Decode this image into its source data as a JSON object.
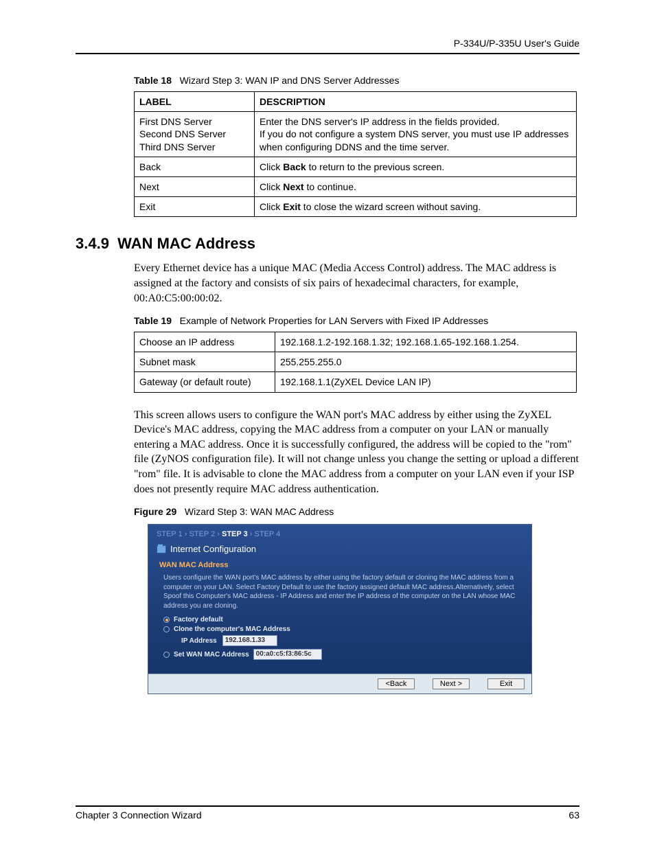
{
  "header": {
    "doc_title": "P-334U/P-335U User's Guide"
  },
  "table18": {
    "caption_label": "Table 18",
    "caption_text": "Wizard Step 3: WAN IP and DNS Server Addresses",
    "head": {
      "label": "LABEL",
      "desc": "DESCRIPTION"
    },
    "rows": [
      {
        "label1": "First DNS Server",
        "label2": "Second DNS Server",
        "label3": "Third DNS Server",
        "desc_line1": "Enter the DNS server's IP address in the fields provided.",
        "desc_line2": "If you do not configure a system DNS server, you must use IP addresses when configuring DDNS and the time server."
      },
      {
        "label": "Back",
        "desc_pre": "Click ",
        "desc_b": "Back",
        "desc_post": " to return to the previous screen."
      },
      {
        "label": "Next",
        "desc_pre": "Click ",
        "desc_b": "Next",
        "desc_post": " to continue."
      },
      {
        "label": "Exit",
        "desc_pre": "Click ",
        "desc_b": "Exit",
        "desc_post": " to close the wizard screen without saving."
      }
    ]
  },
  "section": {
    "number": "3.4.9",
    "title": "WAN MAC Address"
  },
  "para1": "Every Ethernet device has a unique MAC (Media Access Control) address. The MAC address is assigned at the factory and consists of six pairs of hexadecimal characters, for example, 00:A0:C5:00:00:02.",
  "table19": {
    "caption_label": "Table 19",
    "caption_text": "Example of Network Properties for LAN Servers with Fixed IP Addresses",
    "rows": [
      {
        "label": "Choose an IP address",
        "value": "192.168.1.2-192.168.1.32; 192.168.1.65-192.168.1.254."
      },
      {
        "label": "Subnet mask",
        "value": "255.255.255.0"
      },
      {
        "label": "Gateway (or default route)",
        "value": "192.168.1.1(ZyXEL Device LAN IP)"
      }
    ]
  },
  "para2": "This screen allows users to configure the WAN port's MAC address by either using the ZyXEL Device's MAC address, copying the MAC address from a computer on your LAN or manually entering a MAC address. Once it is successfully configured, the address will be copied to the \"rom\" file (ZyNOS configuration file). It will not change unless you change the setting or upload a different \"rom\" file. It is advisable to clone the MAC address from a computer on your LAN even if your ISP does not presently require MAC address authentication.",
  "figure": {
    "caption_label": "Figure 29",
    "caption_text": "Wizard Step 3: WAN MAC Address",
    "steps": {
      "s1": "STEP 1",
      "s2": "STEP 2",
      "s3": "STEP 3",
      "s4": "STEP 4",
      "sep": " › "
    },
    "title": "Internet Configuration",
    "heading": "WAN MAC Address",
    "desc": "Users configure the WAN port's MAC address by either using the factory default or cloning the MAC address from a computer on your LAN. Select Factory Default to use the factory assigned default MAC address.Alternatively, select Spoof this Computer's MAC address - IP Address and enter the IP address of the computer on the LAN whose MAC address you are cloning.",
    "opt_factory": "Factory default",
    "opt_clone": "Clone the computer's MAC Address",
    "ip_label": "IP Address",
    "ip_value": "192.168.1.33",
    "opt_setmac": "Set WAN MAC Address",
    "mac_value": "00:a0:c5:f3:86:5c",
    "buttons": {
      "back": "<Back",
      "next": "Next >",
      "exit": "Exit"
    }
  },
  "footer": {
    "chapter": "Chapter 3 Connection Wizard",
    "page": "63"
  }
}
